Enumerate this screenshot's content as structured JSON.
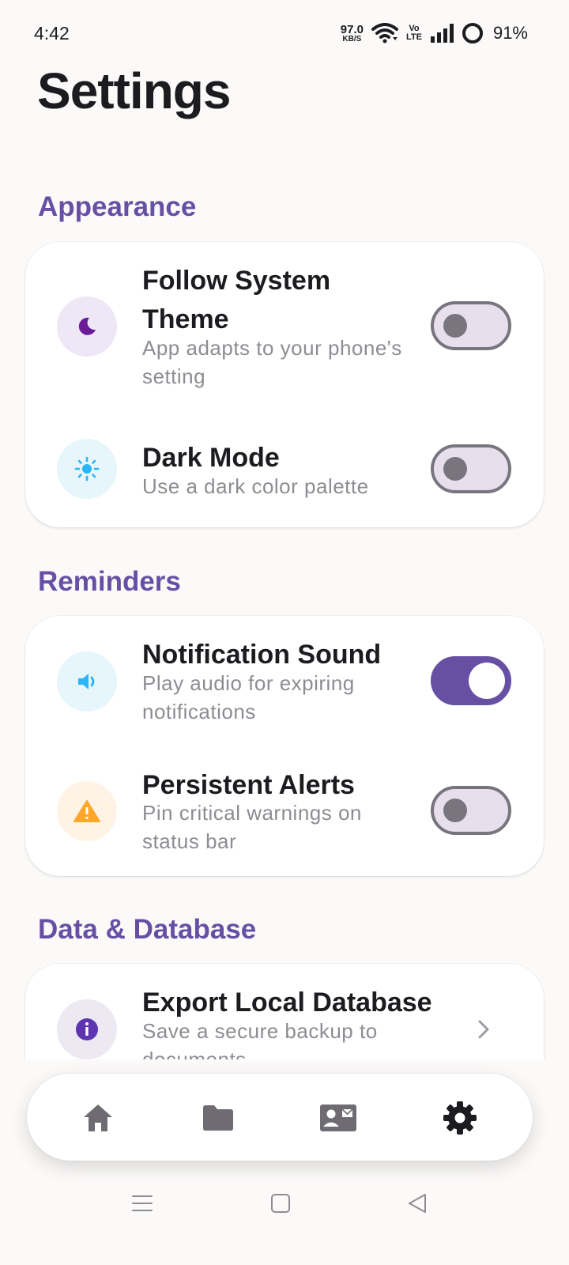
{
  "status_bar": {
    "time": "4:42",
    "net_speed_value": "97.0",
    "net_speed_unit": "KB/S",
    "volte_top": "Vo",
    "volte_bottom": "LTE",
    "battery": "91%"
  },
  "page": {
    "title": "Settings"
  },
  "sections": {
    "appearance": {
      "header": "Appearance",
      "rows": [
        {
          "title_line1": "Follow System",
          "title_line2": "Theme",
          "sub_line1": "App adapts to your phone's",
          "sub_line2": "setting",
          "icon": "moon-icon",
          "toggle_on": false
        },
        {
          "title": "Dark Mode",
          "sub_line1": "Use a dark color palette",
          "icon": "sun-icon",
          "toggle_on": false
        }
      ]
    },
    "reminders": {
      "header": "Reminders",
      "rows": [
        {
          "title": "Notification Sound",
          "sub_line1": "Play audio for expiring",
          "sub_line2": "notifications",
          "icon": "speaker-icon",
          "toggle_on": true
        },
        {
          "title": "Persistent Alerts",
          "sub_line1": "Pin critical warnings on",
          "sub_line2": "status bar",
          "icon": "warning-icon",
          "toggle_on": false
        }
      ]
    },
    "data": {
      "header": "Data & Database",
      "rows": [
        {
          "title": "Export Local Database",
          "sub_line1": "Save a secure backup to",
          "sub_line2": "documents",
          "icon": "info-icon"
        }
      ]
    }
  },
  "bottom_nav": {
    "items": [
      "home-icon",
      "folder-icon",
      "contact-card-icon",
      "settings-gear-icon"
    ],
    "active": "settings-gear-icon"
  },
  "colors": {
    "accent": "#6750a4",
    "moon_bg": "#ede7f6",
    "sun_bg": "#e6f6fb",
    "speaker_bg": "#e6f6fb",
    "warning_bg": "#fff3e6",
    "info_bg": "#ece9f3"
  }
}
